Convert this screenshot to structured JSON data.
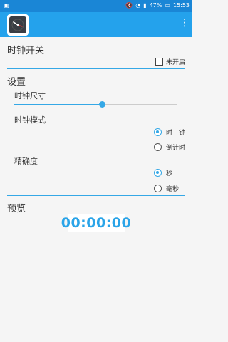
{
  "status_bar": {
    "time": "15:53",
    "battery": "47%"
  },
  "app_bar": {
    "icon_name": "clock-app-icon",
    "menu_icon": "more-vert-icon"
  },
  "clock_switch": {
    "title": "时钟开关",
    "checkbox_label": "未开启",
    "checked": false
  },
  "settings": {
    "title": "设置",
    "size_label": "时钟尺寸",
    "size_level": 0.54,
    "mode_label": "时钟模式",
    "mode_options": [
      "时　钟",
      "倒计时"
    ],
    "mode_selected": 0,
    "precision_label": "精确度",
    "precision_options": [
      "秒",
      "毫秒"
    ],
    "precision_selected": 0
  },
  "preview": {
    "title": "预览",
    "time": "00:00:00"
  },
  "colors": {
    "status_bar": "#1a86d6",
    "app_bar": "#24a2ec",
    "accent": "#35a8e6"
  }
}
